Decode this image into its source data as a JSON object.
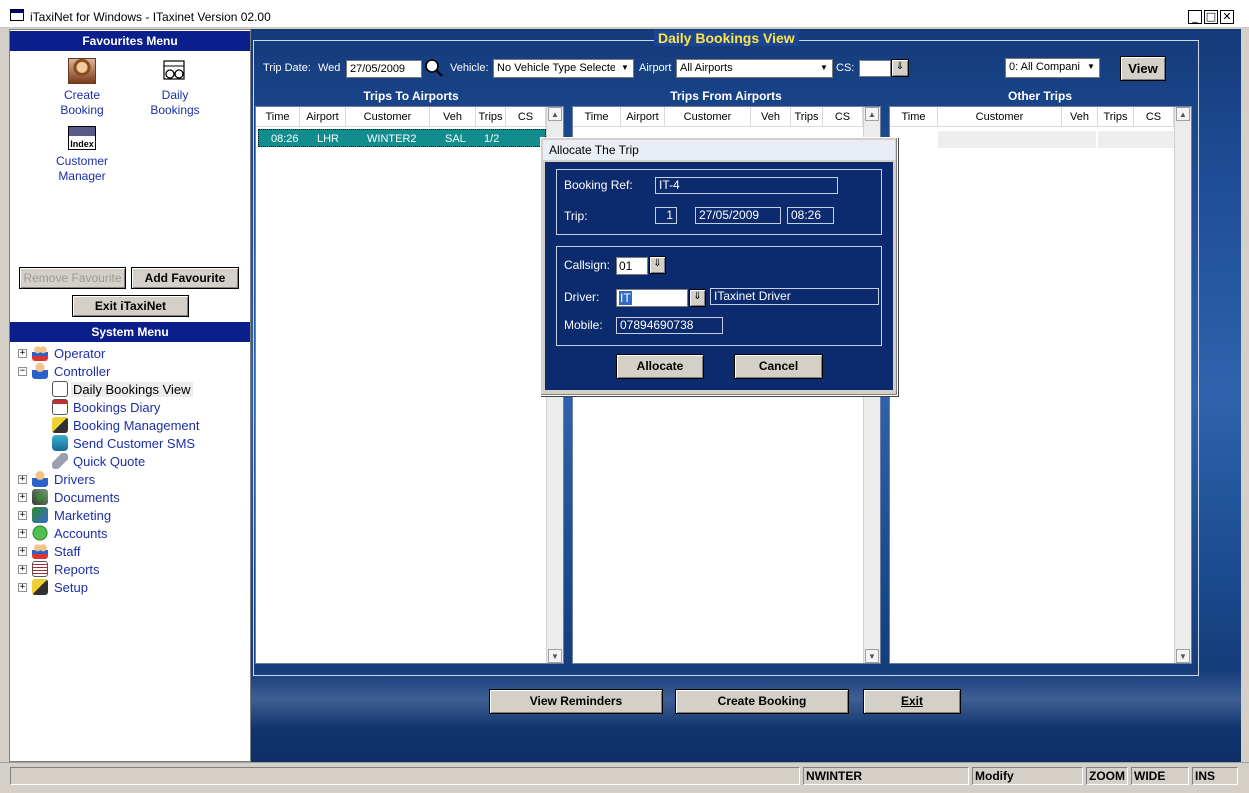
{
  "window": {
    "title": "iTaxiNet for Windows - ITaxinet Version 02.00"
  },
  "favourites": {
    "header": "Favourites Menu",
    "items": [
      {
        "label_line1": "Create",
        "label_line2": "Booking",
        "icon": "person-photo-icon"
      },
      {
        "label_line1": "Daily",
        "label_line2": "Bookings",
        "icon": "calendar-glasses-icon"
      },
      {
        "label_line1": "Customer",
        "label_line2": "Manager",
        "icon": "index-cards-icon"
      }
    ],
    "index_icon_text": "Index",
    "remove_label": "Remove Favourite",
    "add_label": "Add Favourite",
    "exit_label": "Exit iTaxiNet"
  },
  "system_menu": {
    "header": "System Menu",
    "items": [
      {
        "label": "Operator",
        "expander": "+",
        "level": 0
      },
      {
        "label": "Controller",
        "expander": "−",
        "level": 0
      },
      {
        "label": "Daily Bookings View",
        "level": 1,
        "selected": true
      },
      {
        "label": "Bookings Diary",
        "level": 1
      },
      {
        "label": "Booking Management",
        "level": 1
      },
      {
        "label": "Send Customer SMS",
        "level": 1
      },
      {
        "label": "Quick Quote",
        "level": 1
      },
      {
        "label": "Drivers",
        "expander": "+",
        "level": 0
      },
      {
        "label": "Documents",
        "expander": "+",
        "level": 0
      },
      {
        "label": "Marketing",
        "expander": "+",
        "level": 0
      },
      {
        "label": "Accounts",
        "expander": "+",
        "level": 0
      },
      {
        "label": "Staff",
        "expander": "+",
        "level": 0
      },
      {
        "label": "Reports",
        "expander": "+",
        "level": 0
      },
      {
        "label": "Setup",
        "expander": "+",
        "level": 0
      }
    ]
  },
  "view": {
    "title": "Daily Bookings View",
    "trip_date_label": "Trip Date:",
    "weekday": "Wed",
    "date_value": "27/05/2009",
    "vehicle_label": "Vehicle:",
    "vehicle_value": "No Vehicle Type Selecte",
    "airport_label": "Airport",
    "airport_value": "All Airports",
    "cs_label": "CS:",
    "cs_value": "",
    "company_value": "0: All Compani",
    "view_button": "View"
  },
  "lists": {
    "to_airports": {
      "title": "Trips To Airports",
      "columns": [
        "Time",
        "Airport",
        "Customer",
        "Veh",
        "Trips",
        "CS"
      ],
      "rows": [
        {
          "time": "08:26",
          "airport": "LHR",
          "customer": "WINTER2",
          "veh": "SAL",
          "trips": "1/2",
          "cs": ""
        }
      ]
    },
    "from_airports": {
      "title": "Trips From Airports",
      "columns": [
        "Time",
        "Airport",
        "Customer",
        "Veh",
        "Trips",
        "CS"
      ]
    },
    "other": {
      "title": "Other Trips",
      "columns": [
        "Time",
        "Customer",
        "Veh",
        "Trips",
        "CS"
      ]
    }
  },
  "dialog": {
    "title": "Allocate The Trip",
    "booking_ref_label": "Booking Ref:",
    "booking_ref": "IT-4",
    "trip_label": "Trip:",
    "trip_no": "1",
    "trip_date": "27/05/2009",
    "trip_time": "08:26",
    "callsign_label": "Callsign:",
    "callsign": "01",
    "driver_label": "Driver:",
    "driver_code": "IT",
    "driver_name": "ITaxinet Driver",
    "mobile_label": "Mobile:",
    "mobile": "07894690738",
    "allocate_label": "Allocate",
    "cancel_label": "Cancel"
  },
  "bottom_buttons": {
    "reminders": "View Reminders",
    "create": "Create Booking",
    "exit": "Exit"
  },
  "status": {
    "user": "NWINTER",
    "mode": "Modify",
    "zoom": "ZOOM",
    "wide": "WIDE",
    "ins": "INS"
  }
}
